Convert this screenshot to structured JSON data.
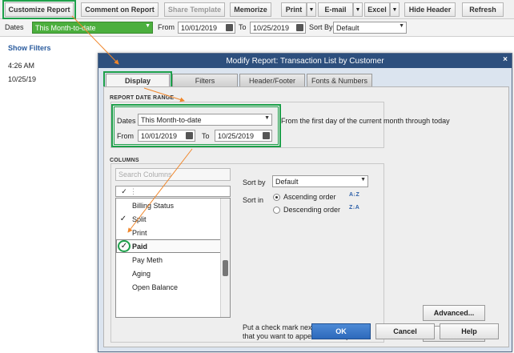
{
  "toolbar": {
    "customize_report": "Customize Report",
    "comment_on_report": "Comment on Report",
    "share_template": "Share Template",
    "memorize": "Memorize",
    "print": "Print",
    "email": "E-mail",
    "excel": "Excel",
    "hide_header": "Hide Header",
    "refresh": "Refresh",
    "dropdown_glyph": "▼"
  },
  "filterbar": {
    "dates_label": "Dates",
    "dates_value": "This Month-to-date",
    "from_label": "From",
    "from_value": "10/01/2019",
    "to_label": "To",
    "to_value": "10/25/2019",
    "sortby_label": "Sort By",
    "sortby_value": "Default"
  },
  "left_panel": {
    "show_filters": "Show Filters",
    "time": "4:26 AM",
    "date": "10/25/19"
  },
  "modal": {
    "title": "Modify Report: Transaction List by Customer",
    "close": "×",
    "tabs": [
      {
        "label": "Display"
      },
      {
        "label": "Filters"
      },
      {
        "label": "Header/Footer"
      },
      {
        "label": "Fonts & Numbers"
      }
    ],
    "date_range": {
      "section_label": "REPORT DATE RANGE",
      "dates_label": "Dates",
      "dates_value": "This Month-to-date",
      "from_label": "From",
      "from_value": "10/01/2019",
      "to_label": "To",
      "to_value": "10/25/2019",
      "description": "From the first day of the current month through today"
    },
    "columns": {
      "section_label": "COLUMNS",
      "search_placeholder": "Search Columns",
      "header_check": "✓",
      "header_dots": "⋮",
      "items": [
        {
          "name": "Billing Status",
          "checked": ""
        },
        {
          "name": "Split",
          "checked": "✓"
        },
        {
          "name": "Print",
          "checked": ""
        },
        {
          "name": "Paid",
          "checked": "✓"
        },
        {
          "name": "Pay Meth",
          "checked": ""
        },
        {
          "name": "Aging",
          "checked": ""
        },
        {
          "name": "Open Balance",
          "checked": ""
        }
      ],
      "sort_by_label": "Sort by",
      "sort_by_value": "Default",
      "sort_in_label": "Sort in",
      "ascending": "Ascending order",
      "descending": "Descending order",
      "asc_icon": "A↓Z",
      "desc_icon": "Z↓A",
      "hint": "Put a check mark next to each column that you want to appear in the report."
    },
    "advanced": "Advanced...",
    "revert": "Revert",
    "ok": "OK",
    "cancel": "Cancel",
    "help": "Help"
  },
  "colors": {
    "highlight_green": "#1da04a",
    "dates_field_green": "#4caf3e",
    "annotation_orange": "#f0862a",
    "title_bar": "#2d4f7d"
  }
}
